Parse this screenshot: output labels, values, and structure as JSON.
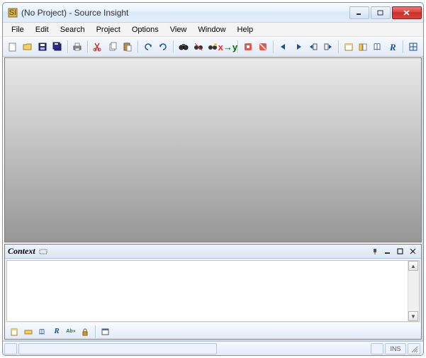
{
  "titlebar": {
    "text": "(No Project) - Source Insight"
  },
  "menus": [
    "File",
    "Edit",
    "Search",
    "Project",
    "Options",
    "View",
    "Window",
    "Help"
  ],
  "toolbar_icons": [
    "new-file",
    "open-file",
    "save-file",
    "save-all",
    "sep",
    "print",
    "sep",
    "cut",
    "copy",
    "paste",
    "sep",
    "undo",
    "redo",
    "sep",
    "find-binoculars",
    "find-all",
    "find-mark",
    "replace-xy",
    "sep",
    "breakpoint-enable",
    "breakpoint-disable",
    "sep",
    "nav-back",
    "nav-forward",
    "nav-up",
    "nav-page",
    "sep",
    "project-window",
    "symbol-window",
    "book",
    "relation-r",
    "sep",
    "window-layout"
  ],
  "context_panel": {
    "title": "Context",
    "header_icons_right": [
      "pin-icon",
      "minimize-icon",
      "maximize-icon",
      "close-icon"
    ],
    "toolbar_icons": [
      "sheet-icon",
      "highlight-icon",
      "book-icon",
      "relation-r-icon",
      "abc-icon",
      "lock-icon",
      "sep",
      "window-icon"
    ]
  },
  "statusbar": {
    "right_text": "INS"
  }
}
